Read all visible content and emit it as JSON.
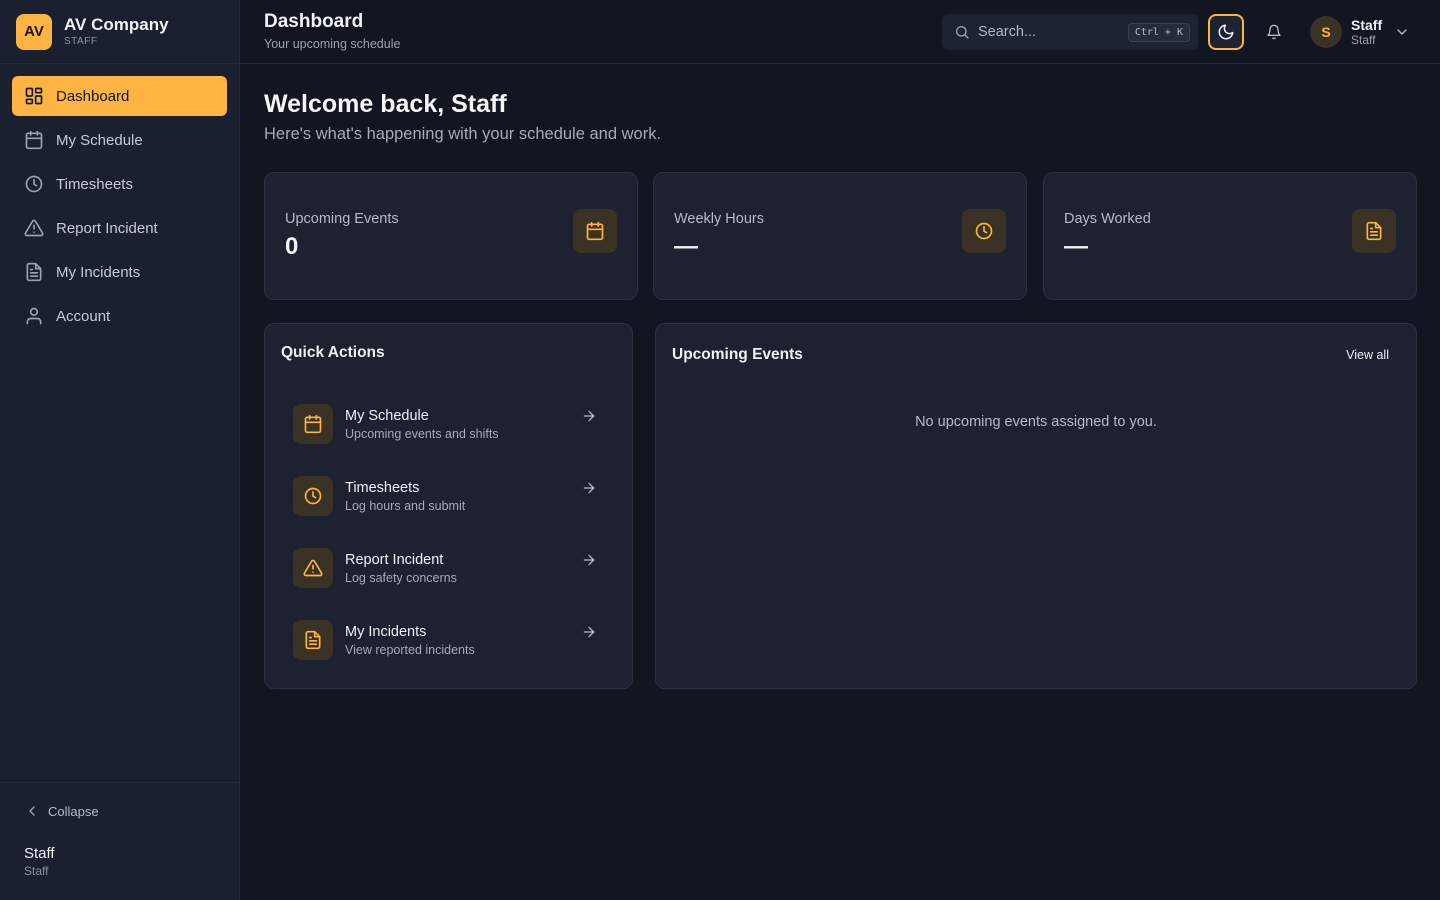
{
  "brand": {
    "logo": "AV",
    "name": "AV Company",
    "role": "STAFF"
  },
  "sidebar": {
    "items": [
      {
        "label": "Dashboard",
        "icon": "dashboard-grid-icon",
        "active": true
      },
      {
        "label": "My Schedule",
        "icon": "calendar-icon",
        "active": false
      },
      {
        "label": "Timesheets",
        "icon": "clock-icon",
        "active": false
      },
      {
        "label": "Report Incident",
        "icon": "warning-triangle-icon",
        "active": false
      },
      {
        "label": "My Incidents",
        "icon": "document-icon",
        "active": false
      },
      {
        "label": "Account",
        "icon": "user-icon",
        "active": false
      }
    ],
    "collapse_label": "Collapse",
    "footer_user": {
      "name": "Staff",
      "role": "Staff"
    }
  },
  "header": {
    "title": "Dashboard",
    "subtitle": "Your upcoming schedule",
    "search_placeholder": "Search...",
    "search_shortcut": "Ctrl + K",
    "user": {
      "initial": "S",
      "name": "Staff",
      "role": "Staff"
    }
  },
  "main": {
    "welcome_title": "Welcome back, Staff",
    "welcome_subtitle": "Here's what's happening with your schedule and work.",
    "stats": [
      {
        "label": "Upcoming Events",
        "value": "0",
        "icon": "calendar-icon"
      },
      {
        "label": "Weekly Hours",
        "value": "—",
        "icon": "clock-icon"
      },
      {
        "label": "Days Worked",
        "value": "—",
        "icon": "document-icon"
      }
    ],
    "quick_actions": {
      "title": "Quick Actions",
      "items": [
        {
          "title": "My Schedule",
          "desc": "Upcoming events and shifts",
          "icon": "calendar-icon"
        },
        {
          "title": "Timesheets",
          "desc": "Log hours and submit",
          "icon": "clock-icon"
        },
        {
          "title": "Report Incident",
          "desc": "Log safety concerns",
          "icon": "warning-triangle-icon"
        },
        {
          "title": "My Incidents",
          "desc": "View reported incidents",
          "icon": "document-icon"
        }
      ]
    },
    "upcoming_events": {
      "title": "Upcoming Events",
      "view_all": "View all",
      "empty_message": "No upcoming events assigned to you."
    }
  },
  "colors": {
    "accent": "#fdb443",
    "background": "#121620",
    "card": "#1d2130",
    "sidebar": "#1b2030"
  }
}
